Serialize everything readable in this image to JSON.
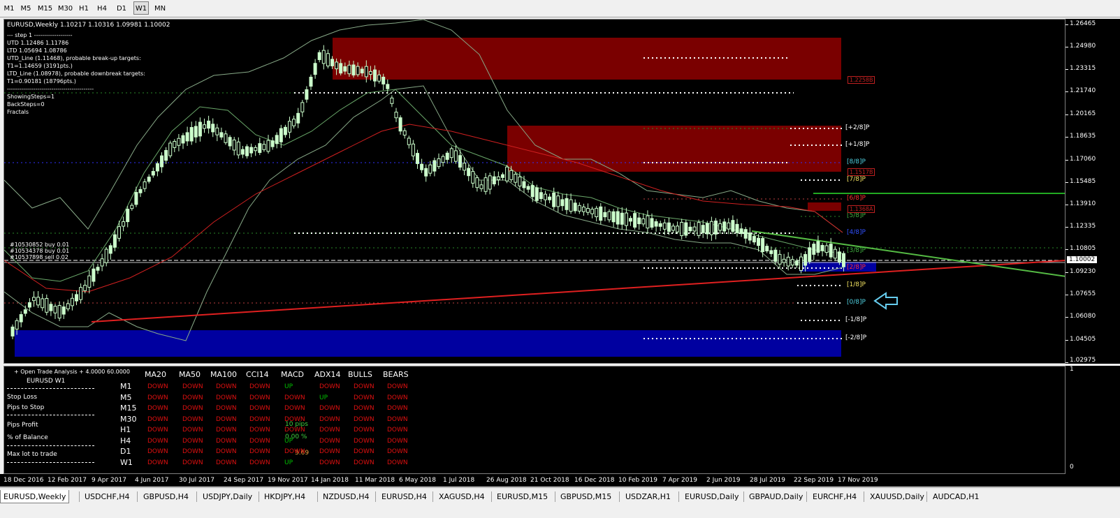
{
  "timeframes": [
    "M1",
    "M5",
    "M15",
    "M30",
    "H1",
    "H4",
    "D1",
    "W1",
    "MN"
  ],
  "active_timeframe": "W1",
  "chart": {
    "header": "EURUSD,Weekly  1.10217 1.10316 1.09981 1.10002",
    "info_lines": [
      "---  step 1  -------------------",
      "UTD 1.12486  1.11786",
      "LTD 1.05694  1.08786",
      "UTD_Line (1.11468), probable break-up targets:",
      "T1=1.14659 (3191pts.)",
      "LTD_Line (1.08978), probable downbreak targets:",
      "T1=0.90181 (18796pts.)",
      "-------------------------------------------",
      "ShowingSteps=1",
      "BackSteps=0",
      "Fractals"
    ],
    "orders": [
      "#10530852 buy 0.01",
      "#10534378 buy 0.01",
      "#10537898 sell 0.02"
    ],
    "murrey_labels": [
      "[+2/8]P",
      "[+1/8]P",
      "[8/8]P",
      "[7/8]P",
      "[6/8]P",
      "[5/8]P",
      "[4/8]P",
      "[3/8]P",
      "[2/8]P",
      "[1/8]P",
      "[0/8]P",
      "[-1/8]P",
      "[-2/8]P"
    ],
    "zone_labels": [
      "1.2258B",
      "1.1517B",
      "1.1368A"
    ],
    "current_price": "1.10002"
  },
  "price_axis": [
    "1.26465",
    "1.24980",
    "1.23315",
    "1.21740",
    "1.20165",
    "1.18635",
    "1.17060",
    "1.15485",
    "1.13910",
    "1.12335",
    "1.10805",
    "1.09230",
    "1.07655",
    "1.06080",
    "1.04505",
    "1.02975"
  ],
  "indicator_axis": [
    "1",
    "0"
  ],
  "time_axis": [
    "18 Dec 2016",
    "12 Feb 2017",
    "9 Apr 2017",
    "4 Jun 2017",
    "30 Jul 2017",
    "24 Sep 2017",
    "19 Nov 2017",
    "14 Jan 2018",
    "11 Mar 2018",
    "6 May 2018",
    "1 Jul 2018",
    "26 Aug 2018",
    "21 Oct 2018",
    "16 Dec 2018",
    "10 Feb 2019",
    "7 Apr 2019",
    "2 Jun 2019",
    "28 Jul 2019",
    "22 Sep 2019",
    "17 Nov 2019"
  ],
  "analysis": {
    "title": "+ Open Trade Analysis + 4.0000 60.0000",
    "symbol": "EURUSD  W1",
    "stop_loss": "Stop Loss",
    "pips_to_stop": "Pips to Stop",
    "pips_profit": "Pips Profit",
    "pct_balance": "% of Balance",
    "max_lot": "Max lot to trade",
    "pips_value": "10 pips",
    "pct_value": "0.00 %",
    "lot_value": "3.69"
  },
  "matrix": {
    "columns": [
      "MA20",
      "MA50",
      "MA100",
      "CCI14",
      "MACD",
      "ADX14",
      "BULLS",
      "BEARS"
    ],
    "rows": [
      {
        "tf": "M1",
        "vals": [
          "DOWN",
          "DOWN",
          "DOWN",
          "DOWN",
          "UP",
          "DOWN",
          "DOWN",
          "DOWN"
        ]
      },
      {
        "tf": "M5",
        "vals": [
          "DOWN",
          "DOWN",
          "DOWN",
          "DOWN",
          "DOWN",
          "UP",
          "DOWN",
          "DOWN"
        ]
      },
      {
        "tf": "M15",
        "vals": [
          "DOWN",
          "DOWN",
          "DOWN",
          "DOWN",
          "DOWN",
          "DOWN",
          "DOWN",
          "DOWN"
        ]
      },
      {
        "tf": "M30",
        "vals": [
          "DOWN",
          "DOWN",
          "DOWN",
          "DOWN",
          "DOWN",
          "DOWN",
          "DOWN",
          "DOWN"
        ]
      },
      {
        "tf": "H1",
        "vals": [
          "DOWN",
          "DOWN",
          "DOWN",
          "DOWN",
          "DOWN",
          "DOWN",
          "DOWN",
          "DOWN"
        ]
      },
      {
        "tf": "H4",
        "vals": [
          "DOWN",
          "DOWN",
          "DOWN",
          "DOWN",
          "UP",
          "DOWN",
          "DOWN",
          "DOWN"
        ]
      },
      {
        "tf": "D1",
        "vals": [
          "DOWN",
          "DOWN",
          "DOWN",
          "DOWN",
          "DOWN",
          "DOWN",
          "DOWN",
          "DOWN"
        ]
      },
      {
        "tf": "W1",
        "vals": [
          "DOWN",
          "DOWN",
          "DOWN",
          "DOWN",
          "UP",
          "DOWN",
          "DOWN",
          "DOWN"
        ]
      }
    ]
  },
  "tabs": [
    "EURUSD,Weekly",
    "USDCHF,H4",
    "GBPUSD,H4",
    "USDJPY,Daily",
    "HKDJPY,H4",
    "NZDUSD,H4",
    "EURUSD,H4",
    "XAGUSD,H4",
    "EURUSD,M15",
    "GBPUSD,M15",
    "USDZAR,H1",
    "EURUSD,Daily",
    "GBPAUD,Daily",
    "EURCHF,H4",
    "XAUUSD,Daily",
    "AUDCAD,H1"
  ],
  "active_tab": "EURUSD,Weekly",
  "colors": {
    "up": "#00c000",
    "down": "#e01010",
    "bull_candle": "#ccffcc",
    "supply_zone": "#7a0000",
    "demand_zone": "#0000a0",
    "ma_red": "#d02020",
    "trend_green": "#55bb44"
  }
}
